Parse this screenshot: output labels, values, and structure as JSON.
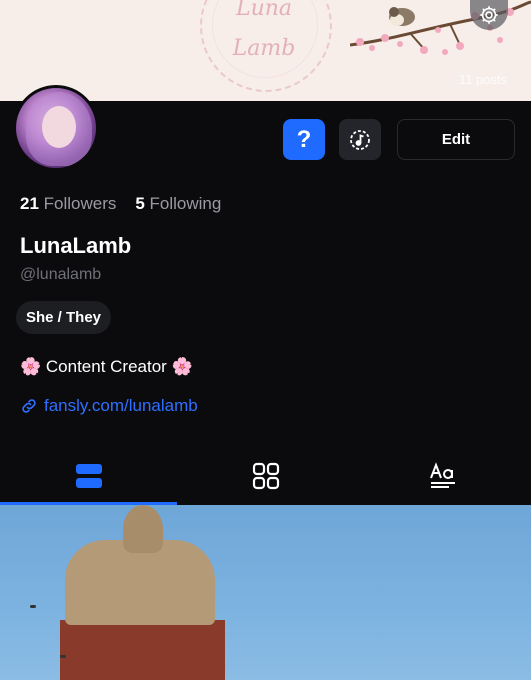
{
  "banner": {
    "title_line1": "Luna",
    "title_line2": "Lamb",
    "posts_count": "11 posts"
  },
  "profile": {
    "followers_count": "21",
    "followers_label": "Followers",
    "following_count": "5",
    "following_label": "Following",
    "display_name": "LunaLamb",
    "handle": "@lunalamb",
    "pronouns": "She / They",
    "bio": "🌸 Content Creator 🌸",
    "link": "fansly.com/lunalamb"
  },
  "actions": {
    "question_label": "?",
    "edit_label": "Edit"
  },
  "tabs": [
    {
      "name": "feed",
      "active": true
    },
    {
      "name": "grid",
      "active": false
    },
    {
      "name": "text",
      "active": false
    }
  ],
  "colors": {
    "accent": "#1f6bff",
    "background": "#0b0b0e",
    "banner": "#f7ede9"
  }
}
